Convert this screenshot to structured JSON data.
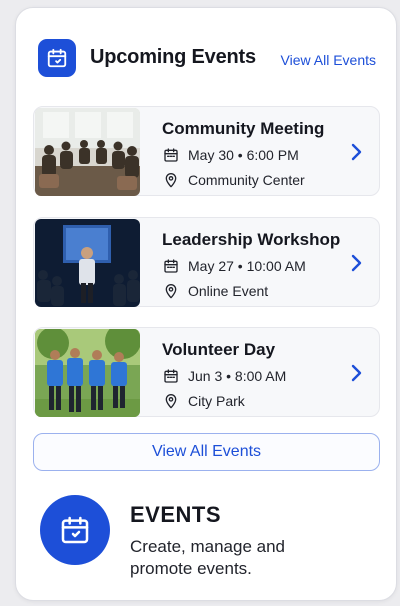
{
  "header": {
    "title": "Upcoming Events",
    "view_all_link": "View All Events",
    "icon": "calendar-icon"
  },
  "events": [
    {
      "title": "Community Meeting",
      "date": "May 30 • 6:00 PM",
      "location": "Community Center",
      "image": "community-meeting-photo"
    },
    {
      "title": "Leadership Workshop",
      "date": "May 27 • 10:00 AM",
      "location": "Online Event",
      "image": "leadership-workshop-photo"
    },
    {
      "title": "Volunteer Day",
      "date": "Jun 3 • 8:00 AM",
      "location": "City Park",
      "image": "volunteer-day-photo"
    }
  ],
  "footer": {
    "button_label": "View All Events"
  },
  "promo": {
    "title": "EVENTS",
    "subtitle": "Create, manage and promote events.",
    "icon": "calendar-icon"
  },
  "colors": {
    "accent": "#1d4fd8",
    "card_background": "#ffffff",
    "event_background": "#f7f8fa"
  }
}
